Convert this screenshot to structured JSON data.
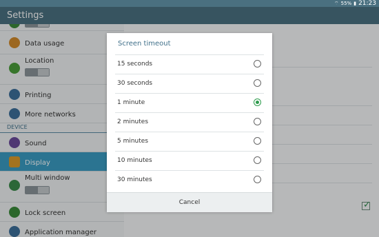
{
  "status": {
    "battery": "55%",
    "time": "21:23"
  },
  "appbar": {
    "title": "Settings"
  },
  "sidebar": {
    "section_label": "DEVICE",
    "items": [
      {
        "label": "Data usage"
      },
      {
        "label": "Location"
      },
      {
        "label": "Printing"
      },
      {
        "label": "More networks"
      },
      {
        "label": "Sound"
      },
      {
        "label": "Display"
      },
      {
        "label": "Multi window"
      },
      {
        "label": "Lock screen"
      },
      {
        "label": "Application manager"
      }
    ]
  },
  "dialog": {
    "title": "Screen timeout",
    "options": [
      {
        "label": "15 seconds",
        "selected": false
      },
      {
        "label": "30 seconds",
        "selected": false
      },
      {
        "label": "1 minute",
        "selected": true
      },
      {
        "label": "2 minutes",
        "selected": false
      },
      {
        "label": "5 minutes",
        "selected": false
      },
      {
        "label": "10 minutes",
        "selected": false
      },
      {
        "label": "30 minutes",
        "selected": false
      }
    ],
    "cancel_label": "Cancel"
  },
  "colors": {
    "appbar": "#4a7080",
    "selected_item": "#3a9bc2",
    "radio_selected": "#2d9b4c"
  }
}
